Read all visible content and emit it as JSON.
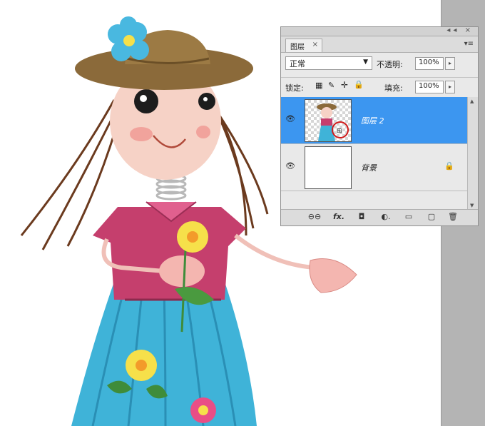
{
  "layers_panel": {
    "tab_title": "图层",
    "close_glyph": "×",
    "window_controls": "◂◂ ×",
    "menu_glyph": "▾≡",
    "blend_mode": "正常",
    "opacity_label": "不透明:",
    "opacity_value": "100%",
    "lock_label": "锁定:",
    "fill_label": "填充:",
    "fill_value": "100%",
    "layers": [
      {
        "name": "图层 2",
        "selected": true,
        "visible": true
      },
      {
        "name": "背景",
        "selected": false,
        "visible": true,
        "locked": true
      }
    ],
    "bottom_icons": [
      "link-icon",
      "fx-icon",
      "mask-icon",
      "adjustment-icon",
      "folder-icon",
      "new-layer-icon",
      "trash-icon"
    ],
    "bottom_glyphs": {
      "link": "⊖⊖",
      "fx": "fx.",
      "mask": "◘",
      "adjust": "◐.",
      "folder": "▭",
      "new": "▢",
      "trash": "🗑"
    }
  },
  "colors": {
    "selection": "#3c96f0",
    "canvas_bg": "#ffffff",
    "panel_bg": "#e9e9e9",
    "annotation_circle": "#d01a1a"
  }
}
